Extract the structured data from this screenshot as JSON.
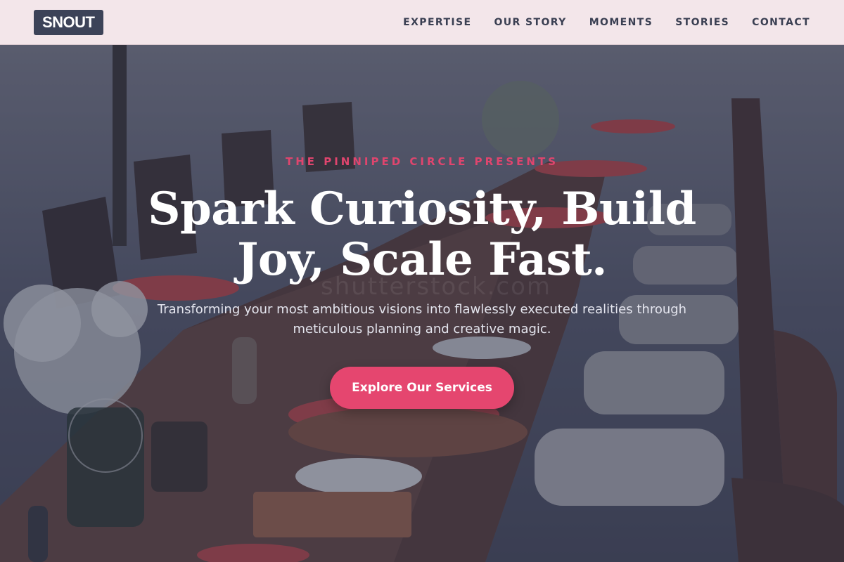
{
  "brand": {
    "logo_text": "SNOUT"
  },
  "nav": {
    "items": [
      {
        "label": "EXPERTISE"
      },
      {
        "label": "OUR STORY"
      },
      {
        "label": "MOMENTS"
      },
      {
        "label": "STORIES"
      },
      {
        "label": "CONTACT"
      }
    ]
  },
  "hero": {
    "eyebrow": "THE PINNIPED CIRCLE PRESENTS",
    "headline_line1": "Spark Curiosity, Build",
    "headline_line2": "Joy, Scale Fast.",
    "subtitle": "Transforming your most ambitious visions into flawlessly executed realities through meticulous planning and creative magic.",
    "cta_label": "Explore Our Services",
    "watermark": "shutterstock.com"
  },
  "colors": {
    "accent": "#e5466f",
    "nav_bg": "#f3e6ea",
    "logo_bg": "#3c4358",
    "text_dark": "#3a3f52"
  }
}
